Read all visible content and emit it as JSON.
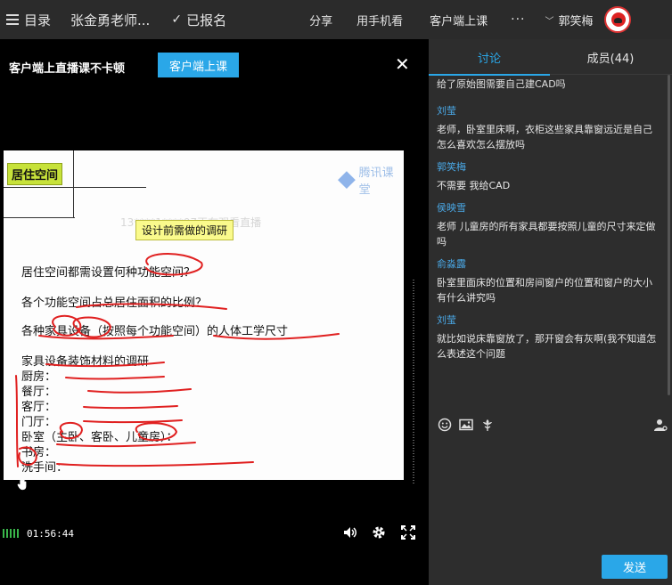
{
  "topbar": {
    "toc_label": "目录",
    "course_title": "张金勇老师...",
    "enrolled_label": "已报名",
    "share_label": "分享",
    "phone_label": "用手机看",
    "client_label": "客户端上课",
    "more_label": "···",
    "user_name": "郭笑梅"
  },
  "promo": {
    "text": "客户端上直播课不卡顿",
    "button_label": "客户端上课"
  },
  "slide": {
    "header": "居住空间",
    "logo_text": "腾讯课堂",
    "watermark": "13****1****97正在观看直播",
    "subtitle": "设计前需做的调研",
    "lines": [
      "居住空间都需设置何种功能空间？",
      "各个功能空间占总居住面积的比例？",
      "各种家具设备（按照每个功能空间）的人体工学尺寸",
      "家具设备装饰材料的调研",
      "厨房：",
      "餐厅：",
      "客厅：",
      "门厅：",
      "卧室（主卧、客卧、儿童房）：",
      "书房：",
      "洗手间："
    ]
  },
  "controls": {
    "time": "01:56:44"
  },
  "panel": {
    "tab_discussion": "讨论",
    "tab_members": "成员(44)",
    "top_message": "给了原始图需要自己建CAD吗",
    "messages": [
      {
        "name": "刘莹",
        "body": "老师，卧室里床啊，衣柜这些家具靠窗远近是自己怎么喜欢怎么摆放吗"
      },
      {
        "name": "郭笑梅",
        "body": "不需要 我给CAD"
      },
      {
        "name": "侯映雪",
        "body": "老师 儿童房的所有家具都要按照儿童的尺寸来定做吗"
      },
      {
        "name": "俞淼露",
        "body": "卧室里面床的位置和房间窗户的位置和窗户的大小有什么讲究吗"
      },
      {
        "name": "刘莹",
        "body": "就比如说床靠窗放了，那开窗会有灰啊(我不知道怎么表述这个问题"
      }
    ],
    "send_label": "发送"
  },
  "colors": {
    "accent": "#2aa7e8",
    "name_blue": "#4aa8e6",
    "ink_red": "#e02020",
    "volume_green": "#39b54a"
  }
}
